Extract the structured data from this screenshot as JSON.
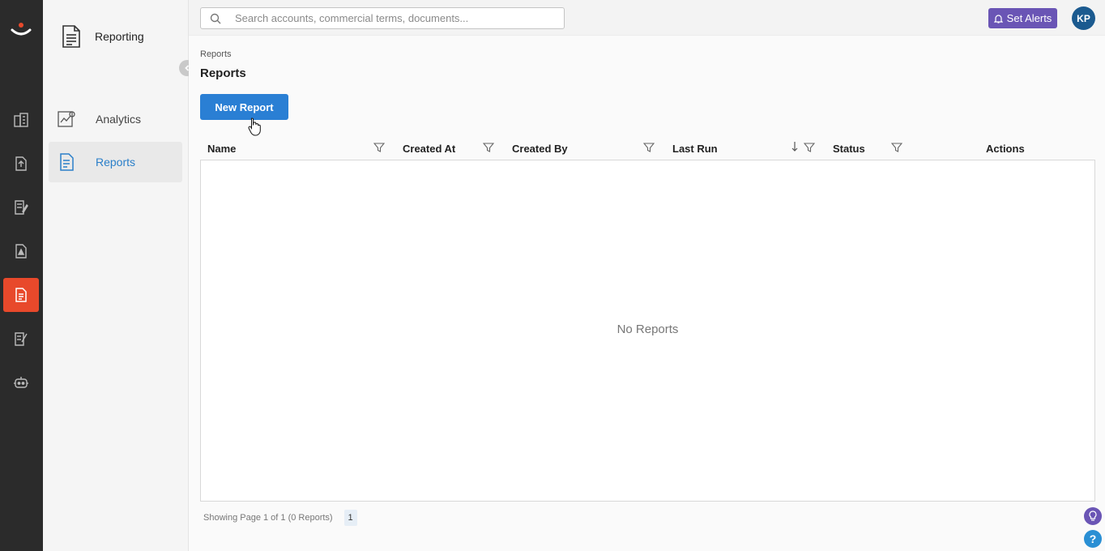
{
  "app": {
    "section_title": "Reporting"
  },
  "sidebar": {
    "items": [
      {
        "label": "Analytics",
        "icon": "analytics-icon"
      },
      {
        "label": "Reports",
        "icon": "reports-icon",
        "active": true
      }
    ]
  },
  "rail": {
    "icons": [
      "accounts-icon",
      "upload-document-icon",
      "contracts-icon",
      "alerts-document-icon",
      "reporting-icon",
      "sign-document-icon",
      "bot-icon"
    ],
    "active_index": 4,
    "active_color": "#e8492b"
  },
  "topbar": {
    "search_placeholder": "Search accounts, commercial terms, documents...",
    "alerts_label": "Set Alerts",
    "avatar_initials": "KP"
  },
  "main": {
    "breadcrumb": "Reports",
    "title": "Reports",
    "new_button": "New Report",
    "columns": [
      "Name",
      "Created At",
      "Created By",
      "Last Run",
      "Status",
      "Actions"
    ],
    "empty_text": "No Reports",
    "footer_text": "Showing Page 1 of 1 (0 Reports)",
    "page_number": "1"
  },
  "colors": {
    "accent": "#2a7fd4",
    "alerts": "#6a55b5",
    "rail_bg": "#2b2b2b"
  }
}
